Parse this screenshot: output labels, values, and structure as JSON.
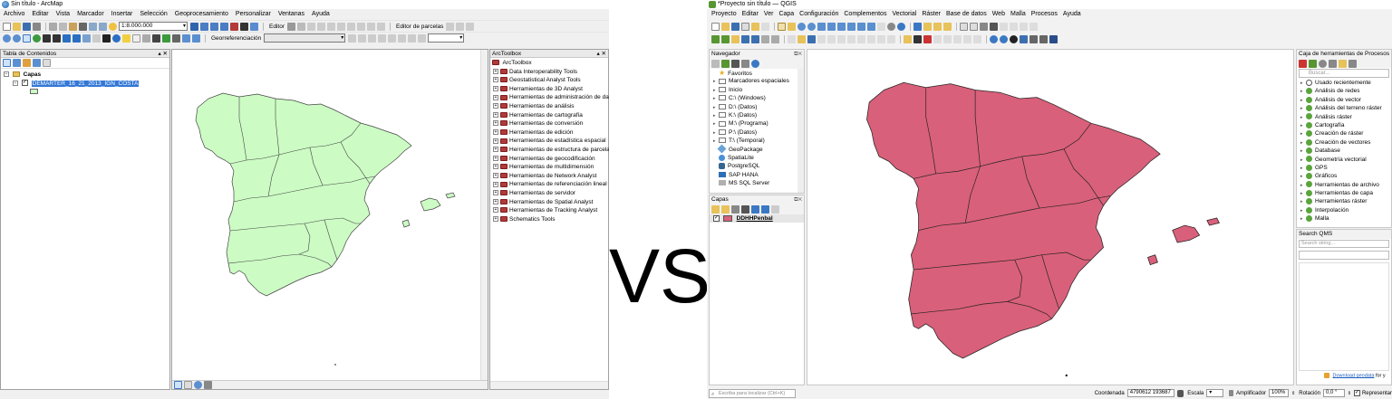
{
  "arcmap": {
    "title": "Sin título - ArcMap",
    "menu": [
      "Archivo",
      "Editar",
      "Vista",
      "Marcador",
      "Insertar",
      "Selección",
      "Geoprocesamiento",
      "Personalizar",
      "Ventanas",
      "Ayuda"
    ],
    "scale": "1:8.000.000",
    "editor_label": "Editor",
    "parcel_editor_label": "Editor de parcelas",
    "georef_label": "Georreferenciación",
    "toc": {
      "title": "Tabla de Contenidos",
      "root_label": "Capas",
      "layer_name": "DEMARTER_16_21_2013_IGN_COSTA"
    },
    "toolbox": {
      "title": "ArcToolbox",
      "root_label": "ArcToolbox",
      "items": [
        "Data Interoperability Tools",
        "Geostatistical Analyst Tools",
        "Herramientas de 3D Analyst",
        "Herramientas de administración de da",
        "Herramientas de análisis",
        "Herramientas de cartografía",
        "Herramientas de conversión",
        "Herramientas de edición",
        "Herramientas de estadística espacial",
        "Herramientas de estructura de parcela",
        "Herramientas de geocodificación",
        "Herramientas de multidimensión",
        "Herramientas de Network Analyst",
        "Herramientas de referenciación lineal",
        "Herramientas de servidor",
        "Herramientas de Spatial Analyst",
        "Herramientas de Tracking Analyst",
        "Schematics Tools"
      ]
    },
    "map_fill": "#ccfcc4"
  },
  "vs_text": "VS",
  "qgis": {
    "title": "*Proyecto sin título — QGIS",
    "menu": [
      "Proyecto",
      "Editar",
      "Ver",
      "Capa",
      "Configuración",
      "Complementos",
      "Vectorial",
      "Ráster",
      "Base de datos",
      "Web",
      "Malla",
      "Procesos",
      "Ayuda"
    ],
    "browser": {
      "title": "Navegador",
      "items": [
        {
          "label": "Favoritos",
          "icon": "star-icon"
        },
        {
          "label": "Marcadores espaciales",
          "icon": "folder-icon"
        },
        {
          "label": "Inicio",
          "icon": "folder-icon"
        },
        {
          "label": "C:\\ (Windows)",
          "icon": "folder-icon"
        },
        {
          "label": "D:\\ (Datos)",
          "icon": "folder-icon"
        },
        {
          "label": "K:\\ (Datos)",
          "icon": "folder-icon"
        },
        {
          "label": "M:\\ (Programa)",
          "icon": "folder-icon"
        },
        {
          "label": "P:\\ (Datos)",
          "icon": "folder-icon"
        },
        {
          "label": "T:\\ (Temporal)",
          "icon": "folder-icon"
        },
        {
          "label": "GeoPackage",
          "icon": "geopackage-icon"
        },
        {
          "label": "SpatiaLite",
          "icon": "spatialite-icon"
        },
        {
          "label": "PostgreSQL",
          "icon": "postgresql-icon"
        },
        {
          "label": "SAP HANA",
          "icon": "sap-hana-icon"
        },
        {
          "label": "MS SQL Server",
          "icon": "mssql-icon"
        }
      ]
    },
    "layers": {
      "title": "Capas",
      "layer_name": "DDHHPenbal"
    },
    "processing": {
      "title": "Caja de herramientas de Procesos",
      "search_placeholder": "Buscar...",
      "items": [
        "Usado recientemente",
        "Análisis de redes",
        "Análisis de vector",
        "Análisis del terreno ráster",
        "Análisis ráster",
        "Cartografía",
        "Creación de ráster",
        "Creación de vectores",
        "Database",
        "Geometría vectorial",
        "GPS",
        "Gráficos",
        "Herramientas de archivo",
        "Herramientas de capa",
        "Herramientas ráster",
        "Interpolación",
        "Malla"
      ]
    },
    "search_qms": {
      "title": "Search QMS",
      "placeholder": "Search string...",
      "download_link": "Download geodata",
      "download_suffix": "for y"
    },
    "locator_placeholder": "Escriba para localizar (Ctrl+K)",
    "status": {
      "coord_label": "Coordenada",
      "coord_value": "4790612  193687",
      "scale_label": "Escala",
      "magnifier_label": "Amplificador",
      "magnifier_value": "100%",
      "rotation_label": "Rotación",
      "rotation_value": "0,0 °",
      "render_label": "Representar"
    },
    "map_fill": "#d9607a"
  }
}
